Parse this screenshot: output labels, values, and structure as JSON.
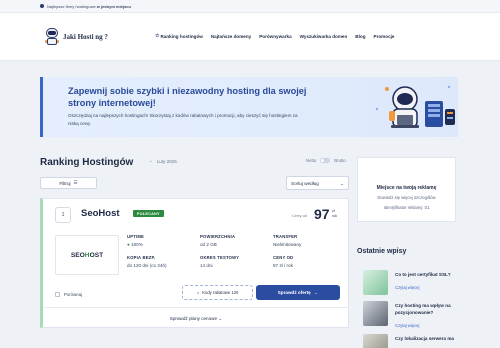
{
  "topbar": {
    "prefix": "Najlepsze firmy hostingowe",
    "emphasis": "w jednym miejscu"
  },
  "header": {
    "brand": "Jaki Hosti  ng ?",
    "nav": [
      {
        "label": "Ranking hostingów",
        "icon": "star-icon"
      },
      {
        "label": "Najtańsze domeny"
      },
      {
        "label": "Porównywarka"
      },
      {
        "label": "Wyszukiwarka domen"
      },
      {
        "label": "Blog"
      },
      {
        "label": "Promocje"
      }
    ]
  },
  "hero": {
    "title": "Zapewnij sobie szybki i niezawodny hosting dla swojej strony internetowej!",
    "description": "Oszczędzaj na najlepszych hostingach! Skorzystaj z kodów rabatowych i promocji, aby cieszyć się hostingiem za niską cenę."
  },
  "ranking": {
    "title": "Ranking Hostingów",
    "date": "Luty 2025",
    "toggle_left": "Netto",
    "toggle_right": "Brutto",
    "filter_label": "Filtruj",
    "sort_label": "Sortuj według"
  },
  "card": {
    "rank": "1",
    "name": "SeoHost",
    "badge": "POLECANY",
    "price_prefix": "Ceny od",
    "price": "97",
    "price_unit_line1": "zł",
    "price_unit_line2": "rok",
    "logo_left": "SEO",
    "logo_mid": "H",
    "logo_right": "OST",
    "specs": [
      {
        "key": "UPTIME",
        "value": "100%"
      },
      {
        "key": "POWIERZCHNIA",
        "value": "od 2 GB"
      },
      {
        "key": "TRANSFER",
        "value": "Nielimitowany"
      },
      {
        "key": "KOPIA BEZP.",
        "value": "do 120 dni (co 24h)"
      },
      {
        "key": "OKRES TESTOWY",
        "value": "14 dni"
      },
      {
        "key": "CENY OD",
        "value": "97 zł / rok"
      }
    ],
    "compare_label": "Porównaj",
    "code_button": "Kody rabatowe 120",
    "offer_button": "Sprawdź ofertę",
    "plans_label": "Sprawdź plany cenowe"
  },
  "ad": {
    "title": "Miejsce na twoją reklamę",
    "line1": "Dowiedz się więcej szczegółów",
    "line2": "Identyfikator reklamy: 01"
  },
  "sidebar": {
    "title": "Ostatnie wpisy",
    "posts": [
      {
        "title": "Co to jest certyfikat SSL?",
        "more": "Czytaj więcej"
      },
      {
        "title": "Czy hosting ma wpływ na pozycjonowanie?",
        "more": "Czytaj więcej"
      },
      {
        "title": "Czy lokalizacja serwera ma"
      }
    ]
  },
  "colors": {
    "primary": "#2a4da1",
    "accent_green": "#2c8a3e",
    "hero_title": "#2b4a9a",
    "link": "#3a66c8"
  }
}
